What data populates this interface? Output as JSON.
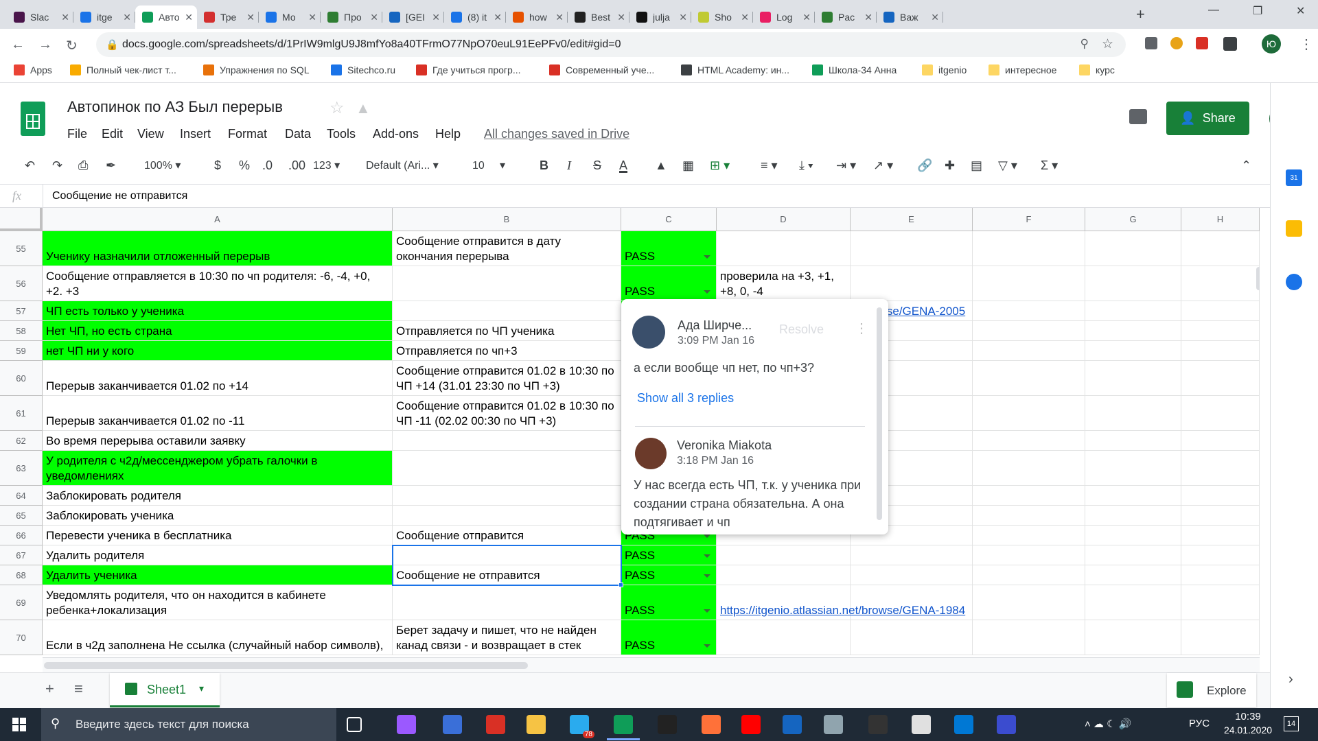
{
  "browser": {
    "tabs": [
      {
        "title": "Slac",
        "color": "#4a154b"
      },
      {
        "title": "itge",
        "color": "#1a73e8"
      },
      {
        "title": "Авто",
        "color": "#0f9d58",
        "active": true
      },
      {
        "title": "Тре",
        "color": "#d32f2f"
      },
      {
        "title": "Мо",
        "color": "#1a73e8"
      },
      {
        "title": "Про",
        "color": "#2e7d32"
      },
      {
        "title": "[GEI",
        "color": "#1565c0"
      },
      {
        "title": "(8) it",
        "color": "#1a73e8"
      },
      {
        "title": "how",
        "color": "#e65100"
      },
      {
        "title": "Best",
        "color": "#222222"
      },
      {
        "title": "julja",
        "color": "#111111"
      },
      {
        "title": "Sho",
        "color": "#c0ca33"
      },
      {
        "title": "Log",
        "color": "#e91e63"
      },
      {
        "title": "Pac",
        "color": "#2e7d32"
      },
      {
        "title": "Важ",
        "color": "#1565c0"
      }
    ],
    "url": "docs.google.com/spreadsheets/d/1PrIW9mlgU9J8mfYo8a40TFrmO77NpO70euL91EePFv0/edit#gid=0",
    "bookmarks": [
      {
        "label": "Apps",
        "color": "#ea4335"
      },
      {
        "label": "Полный чек-лист т...",
        "color": "#f9ab00"
      },
      {
        "label": "Упражнения по SQL",
        "color": "#e8710a"
      },
      {
        "label": "Sitechco.ru",
        "color": "#1a73e8"
      },
      {
        "label": "Где учиться прогр...",
        "color": "#d93025"
      },
      {
        "label": "Современный уче...",
        "color": "#d93025"
      },
      {
        "label": "HTML Academy: ин...",
        "color": "#3c4043"
      },
      {
        "label": "Школа-34 Анна",
        "color": "#0f9d58"
      },
      {
        "label": "itgenio",
        "color": "#fdd663"
      },
      {
        "label": "интересное",
        "color": "#fdd663"
      },
      {
        "label": "курс",
        "color": "#fdd663"
      }
    ]
  },
  "doc": {
    "title": "Автопинок по АЗ Был перерыв",
    "menu": [
      "File",
      "Edit",
      "View",
      "Insert",
      "Format",
      "Data",
      "Tools",
      "Add-ons",
      "Help"
    ],
    "saved_status": "All changes saved in Drive",
    "share_label": "Share",
    "user_initial": "Ю"
  },
  "toolbar": {
    "zoom": "100%",
    "currency": "$",
    "percent": "%",
    "dec_less": ".0",
    "dec_more": ".00",
    "format": "123",
    "font": "Default (Ari...",
    "font_size": "10",
    "bold": "B",
    "italic": "I",
    "strike": "S",
    "text_color": "A"
  },
  "formula_bar": {
    "fx": "fx",
    "value": "Сообщение не отправится"
  },
  "grid": {
    "columns": [
      "A",
      "B",
      "C",
      "D",
      "E",
      "F",
      "G",
      "H"
    ],
    "rows": [
      {
        "num": "55",
        "a": "Ученику назначили отложенный перерыв",
        "a_green": true,
        "b": "Сообщение отправится в дату окончания перерыва",
        "c": "PASS",
        "d": ""
      },
      {
        "num": "56",
        "a": "Сообщение отправляется в 10:30 по чп родителя: -6, -4, +0, +2. +3",
        "a_green": false,
        "b": "",
        "c": "PASS",
        "d": "проверила на +3, +1, +8, 0, -4"
      },
      {
        "num": "57",
        "a": "ЧП есть только у ученика",
        "a_green": true,
        "b": "",
        "c": "",
        "d": "https://itgenio.atlassian.net/browse/GENA-2005",
        "d_link": true
      },
      {
        "num": "58",
        "a": "Нет ЧП, но есть страна",
        "a_green": true,
        "b": "Отправляется по ЧП ученика",
        "c": "",
        "d": ""
      },
      {
        "num": "59",
        "a": "нет ЧП ни у кого",
        "a_green": true,
        "b": "Отправляется по чп+3",
        "c": "",
        "d": ""
      },
      {
        "num": "60",
        "a": "Перерыв заканчивается 01.02 по +14",
        "a_green": false,
        "b": "Сообщение отправится 01.02 в 10:30 по ЧП +14 (31.01 23:30 по ЧП +3)",
        "c": "",
        "d": ""
      },
      {
        "num": "61",
        "a": "Перерыв заканчивается 01.02 по -11",
        "a_green": false,
        "b": "Сообщение отправится 01.02 в 10:30 по ЧП -11 (02.02 00:30 по ЧП +3)",
        "c": "",
        "d": ""
      },
      {
        "num": "62",
        "a": "Во время перерыва оставили заявку",
        "a_green": false,
        "b": "",
        "c": "",
        "d": ""
      },
      {
        "num": "63",
        "a": "У родителя с ч2д/мессенджером убрать галочки в уведомлениях",
        "a_green": true,
        "b": "",
        "c": "",
        "d": ""
      },
      {
        "num": "64",
        "a": "Заблокировать родителя",
        "a_green": false,
        "b": "",
        "c": "",
        "d": ""
      },
      {
        "num": "65",
        "a": "Заблокировать ученика",
        "a_green": false,
        "b": "",
        "c": "",
        "d": ""
      },
      {
        "num": "66",
        "a": "Перевести ученика в бесплатника",
        "a_green": false,
        "b": "Сообщение отправится",
        "c": "PASS",
        "d": ""
      },
      {
        "num": "67",
        "a": "Удалить родителя",
        "a_green": false,
        "b": "",
        "c": "PASS",
        "d": ""
      },
      {
        "num": "68",
        "a": "Удалить ученика",
        "a_green": true,
        "b": "Сообщение не отправится",
        "c": "PASS",
        "d": ""
      },
      {
        "num": "69",
        "a": "Уведомлять родителя, что он находится в кабинете ребенка+локализация",
        "a_green": false,
        "b": "",
        "c": "PASS",
        "d": "https://itgenio.atlassian.net/browse/GENA-1984",
        "d_link": true
      },
      {
        "num": "70",
        "a": "Если в ч2д заполнена Не ссылка (случайный набор символв),",
        "a_green": false,
        "b": "Берет задачу и пишет, что не найден канад связи - и возвращает в стек",
        "c": "PASS",
        "d": ""
      }
    ]
  },
  "comment": {
    "author1": "Ада Ширче...",
    "time1": "3:09 PM Jan 16",
    "resolve": "Resolve",
    "text1": "а если вообще чп нет, по чп+3?",
    "show_replies": "Show all 3 replies",
    "author2": "Veronika Miakota",
    "time2": "3:18 PM Jan 16",
    "text2": "У нас всегда есть ЧП, т.к. у ученика при создании страна обязательна. А она подтягивает и чп"
  },
  "sheets": {
    "active": "Sheet1",
    "explore": "Explore"
  },
  "taskbar": {
    "search_placeholder": "Введите здесь текст для поиска",
    "lang": "РУС",
    "time": "10:39",
    "date": "24.01.2020",
    "notif_count": "14",
    "telegram_badge": "78"
  }
}
